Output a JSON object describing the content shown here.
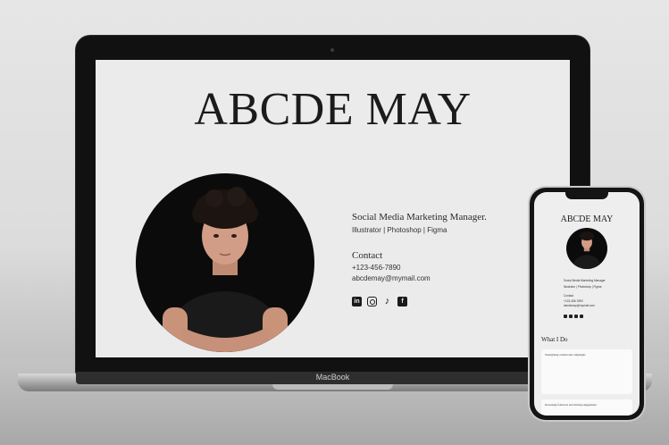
{
  "laptop": {
    "brand": "MacBook",
    "site": {
      "title": "ABCDE MAY",
      "role": "Social Media Marketing Manager.",
      "skills": "Illustrator | Photoshop | Figma",
      "contact_heading": "Contact",
      "phone": "+123-456-7890",
      "email": "abcdemay@mymail.com",
      "socials": [
        "linkedin-icon",
        "instagram-icon",
        "tiktok-icon",
        "facebook-icon"
      ]
    }
  },
  "phone": {
    "site": {
      "title": "ABCDE MAY",
      "role": "Social Media Marketing Manager.",
      "skills": "Illustrator | Photoshop | Figma",
      "contact_heading": "Contact",
      "phone": "+123-456-7890",
      "email": "abcdemay@mymail.com",
      "section_heading": "What I Do",
      "cards": [
        {
          "heading": "Strategizing content and campaigns"
        },
        {
          "heading": "Increasing followers and driving engagement"
        }
      ]
    }
  },
  "colors": {
    "screen_bg": "#ebebeb",
    "text": "#1b1b1b",
    "photo_bg": "#0b0b0b"
  }
}
